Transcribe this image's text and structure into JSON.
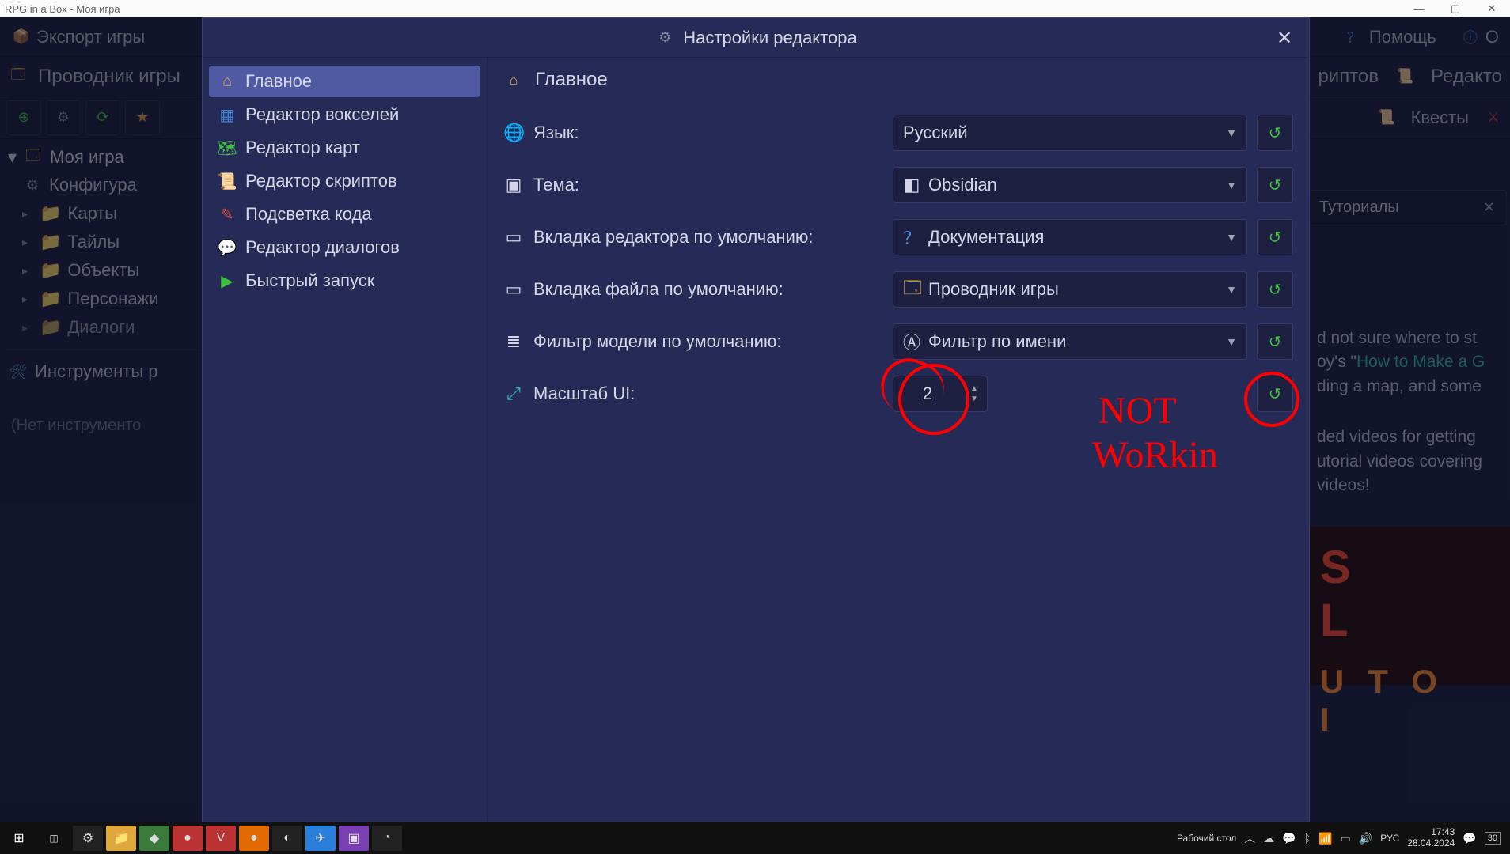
{
  "window_title": "RPG in a Box - Моя игра",
  "topmenu": {
    "export": "Экспорт игры",
    "help": "Помощь",
    "about_truncated": "О"
  },
  "subtop": {
    "explorer": "Проводник игры",
    "scripts_tab_truncated": "риптов",
    "editor_tab_truncated": "Редакто"
  },
  "toolbar_right": {
    "quests": "Квесты"
  },
  "tree": {
    "root": "Моя игра",
    "config_truncated": "Конфигура",
    "maps": "Карты",
    "tiles": "Тайлы",
    "objects": "Объекты",
    "characters": "Персонажи",
    "dialogs_truncated": "Диалоги"
  },
  "tools": {
    "title_truncated": "Инструменты р",
    "empty_truncated": "(Нет инструменто"
  },
  "right_tab": {
    "label_truncated": "Туториалы"
  },
  "right_text": {
    "l1": "d not sure where to st",
    "l2_a": "oy's \"",
    "l2_link": "How to Make a G",
    "l3": "ding a map, and some",
    "l4": "ded videos for getting",
    "l5": "utorial videos covering",
    "l6": "videos!"
  },
  "modal": {
    "title": "Настройки редактора",
    "categories": [
      "Главное",
      "Редактор вокселей",
      "Редактор карт",
      "Редактор скриптов",
      "Подсветка кода",
      "Редактор диалогов",
      "Быстрый запуск"
    ],
    "header": "Главное",
    "rows": {
      "language_label": "Язык:",
      "language_value": "Русский",
      "theme_label": "Тема:",
      "theme_value": "Obsidian",
      "editor_tab_label": "Вкладка редактора по умолчанию:",
      "editor_tab_value": "Документация",
      "file_tab_label": "Вкладка файла по умолчанию:",
      "file_tab_value": "Проводник игры",
      "model_filter_label": "Фильтр модели по умолчанию:",
      "model_filter_value": "Фильтр по имени",
      "ui_scale_label": "Масштаб UI:",
      "ui_scale_value": "2"
    }
  },
  "annotation": {
    "line1": "NOT",
    "line2": "WoRkin"
  },
  "taskbar": {
    "desktop_label": "Рабочий стол",
    "lang": "РУС",
    "time": "17:43",
    "date": "28.04.2024",
    "day_box": "30"
  }
}
